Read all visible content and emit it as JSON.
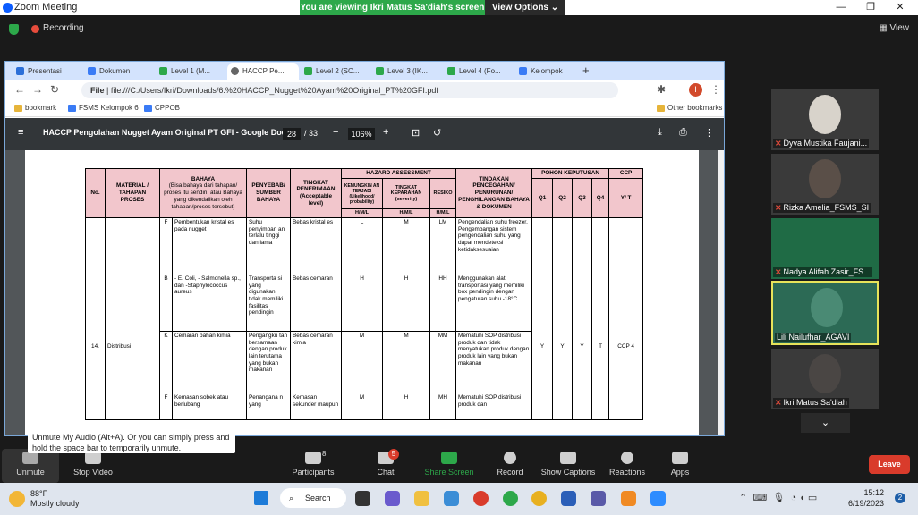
{
  "zoom": {
    "app_title": "Zoom Meeting",
    "share_banner": "You are viewing Ikri Matus Sa'diah's screen",
    "view_options": "View Options",
    "recording": "Recording",
    "view": "View"
  },
  "browser": {
    "tabs": [
      "Presentasi",
      "Dokumen",
      "Level 1 (M...",
      "HACCP Pe...",
      "Level 2 (SC...",
      "Level 3 (IK...",
      "Level 4 (Fo...",
      "Kelompok"
    ],
    "url_scheme": "File",
    "url": "file:///C:/Users/Ikri/Downloads/6.%20HACCP_Nugget%20Ayam%20Original_PT%20GFI.pdf",
    "bookmarks": [
      "bookmark",
      "FSMS Kelompok 6",
      "CPPOB"
    ],
    "other_bookmarks": "Other bookmarks",
    "profile_initial": "I"
  },
  "pdf": {
    "title": "HACCP Pengolahan Nugget Ayam Original PT GFI - Google Docs",
    "page": "28",
    "total": "/ 33",
    "zoom": "106%"
  },
  "table": {
    "headers": {
      "no": "No.",
      "material": "MATERIAL / TAHAPAN PROSES",
      "bahaya": "BAHAYA",
      "bahaya_sub": "(Bisa bahaya dari tahapan/ proses itu sendiri, atau Bahaya yang dikendalikan oleh tahapan/proses tersebut)",
      "penyebab": "PENYEBAB/ SUMBER BAHAYA",
      "tingkat": "TINGKAT PENERIMAAN (Acceptable level)",
      "hazard": "HAZARD ASSESSMENT",
      "kemungkinan": "KEMUNGKIN AN TERJADI (Likelihood/ probability)",
      "keparahan": "TINGKAT KEPARAHAN (severity)",
      "resiko": "RESIKO",
      "hml": "H/M/L",
      "tindakan": "TINDAKAN PENCEGAHAN/ PENURUNAN/ PENGHILANGAN BAHAYA & DOKUMEN",
      "pohon": "POHON KEPUTUSAN",
      "ccp": "CCP",
      "q1": "Q1",
      "q2": "Q2",
      "q3": "Q3",
      "q4": "Q4",
      "yt": "Y/ T"
    },
    "row_top": {
      "type": "F",
      "bahaya": "Pembentukan kristal es pada nugget",
      "penyebab": "Suhu penyimpan an terlalu tinggi dan lama",
      "tingkat": "Bebas kristal es",
      "k": "L",
      "p": "M",
      "r": "LM",
      "tindakan": "Pengendalian suhu freezer, Pengembangan sistem pengendalian suhu yang dapat mendeteksi ketidaksesuaian"
    },
    "group": {
      "no": "14.",
      "material": "Distribusi",
      "q1": "Y",
      "q2": "Y",
      "q3": "Y",
      "q4": "T",
      "ccp": "CCP 4"
    },
    "rows": [
      {
        "type": "B",
        "bahaya": "- E. Coli, - Salmonella sp., dan -Staphylococcus aureus",
        "penyebab": "Transporta si yang digunakan tidak memiliki fasilitas pendingin",
        "tingkat": "Bebas cemaran",
        "k": "H",
        "p": "H",
        "r": "HH",
        "tindakan": "Menggunakan alat transportasi yang memiliki box pendingin dengan pengaturan suhu -18°C"
      },
      {
        "type": "K",
        "bahaya": "Cemaran bahan kimia",
        "penyebab": "Pengangku tan bersamaan dengan produk lain terutama yang bukan makanan",
        "tingkat": "Bebas cemaran kimia",
        "k": "M",
        "p": "M",
        "r": "MM",
        "tindakan": "Mematuhi SOP distribusi produk dan tidak menyatukan produk dengan produk lain yang bukan makanan"
      },
      {
        "type": "F",
        "bahaya": "Kemasan sobek atau berlubang",
        "penyebab": "Penangana n yang",
        "tingkat": "Kemasan sekunder maupun",
        "k": "M",
        "p": "H",
        "r": "MH",
        "tindakan": "Mematuhi SOP distribusi produk dan"
      }
    ]
  },
  "participants": [
    {
      "name": "Dyva Mustika Faujani...",
      "color": "#d8d3cb"
    },
    {
      "name": "Rizka Amelia_FSMS_SI",
      "color": "#5a4f48"
    },
    {
      "name": "Nadya Alifah Zasir_FS...",
      "color": "#1f6b45"
    },
    {
      "name": "Lili Nailufhar_AGAVI",
      "color": "#2c6a55"
    },
    {
      "name": "Ikri Matus Sa'diah",
      "color": "#4a4644"
    }
  ],
  "controls": {
    "tooltip": "Unmute My Audio (Alt+A). Or you can simply press and hold the space bar to temporarily unmute.",
    "unmute": "Unmute",
    "stop_video": "Stop Video",
    "participants": "Participants",
    "participants_count": "8",
    "chat": "Chat",
    "chat_badge": "5",
    "share": "Share Screen",
    "record": "Record",
    "captions": "Show Captions",
    "reactions": "Reactions",
    "apps": "Apps",
    "leave": "Leave"
  },
  "taskbar": {
    "temp": "88°F",
    "weather": "Mostly cloudy",
    "search": "Search",
    "time": "15:12",
    "date": "6/19/2023",
    "notif_count": "2"
  },
  "colors": {
    "zoom_green": "#2da84a",
    "leave_red": "#d93b2b",
    "table_header": "#f2c6cc"
  }
}
